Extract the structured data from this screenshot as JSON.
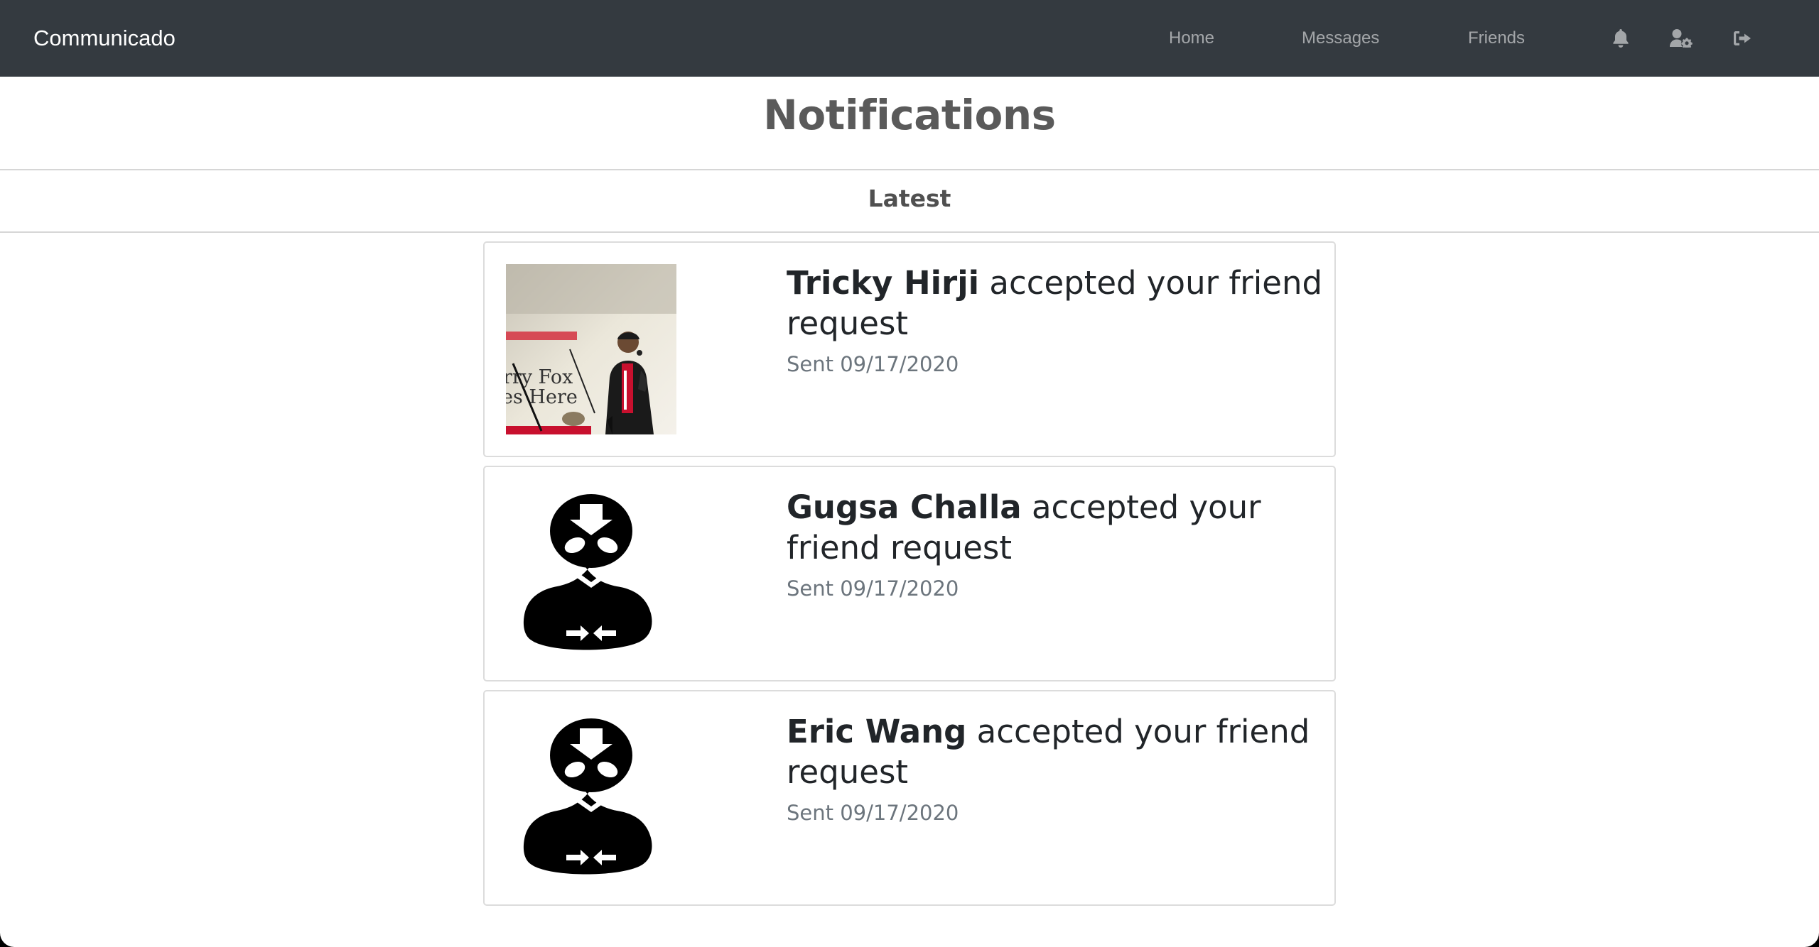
{
  "navbar": {
    "brand": "Communicado",
    "links": [
      "Home",
      "Messages",
      "Friends"
    ],
    "icons": [
      "bell-icon",
      "user-settings-icon",
      "sign-out-icon"
    ]
  },
  "header": {
    "title": "Notifications",
    "section": "Latest"
  },
  "notifications": [
    {
      "name": "Tricky Hirji",
      "message": "accepted your friend request",
      "date": "Sent 09/17/2020",
      "avatar": "photo",
      "photo_sign_text": "rry Fox\nes Here"
    },
    {
      "name": "Gugsa Challa",
      "message": "accepted your friend request",
      "date": "Sent 09/17/2020",
      "avatar": "default-avatar-icon"
    },
    {
      "name": "Eric Wang",
      "message": "accepted your friend request",
      "date": "Sent 09/17/2020",
      "avatar": "default-avatar-icon"
    }
  ],
  "colors": {
    "navbar": "#343a40",
    "nav_link": "#9a9da0",
    "title": "#5a5a5a",
    "text": "#212529",
    "muted": "#6c757d"
  }
}
